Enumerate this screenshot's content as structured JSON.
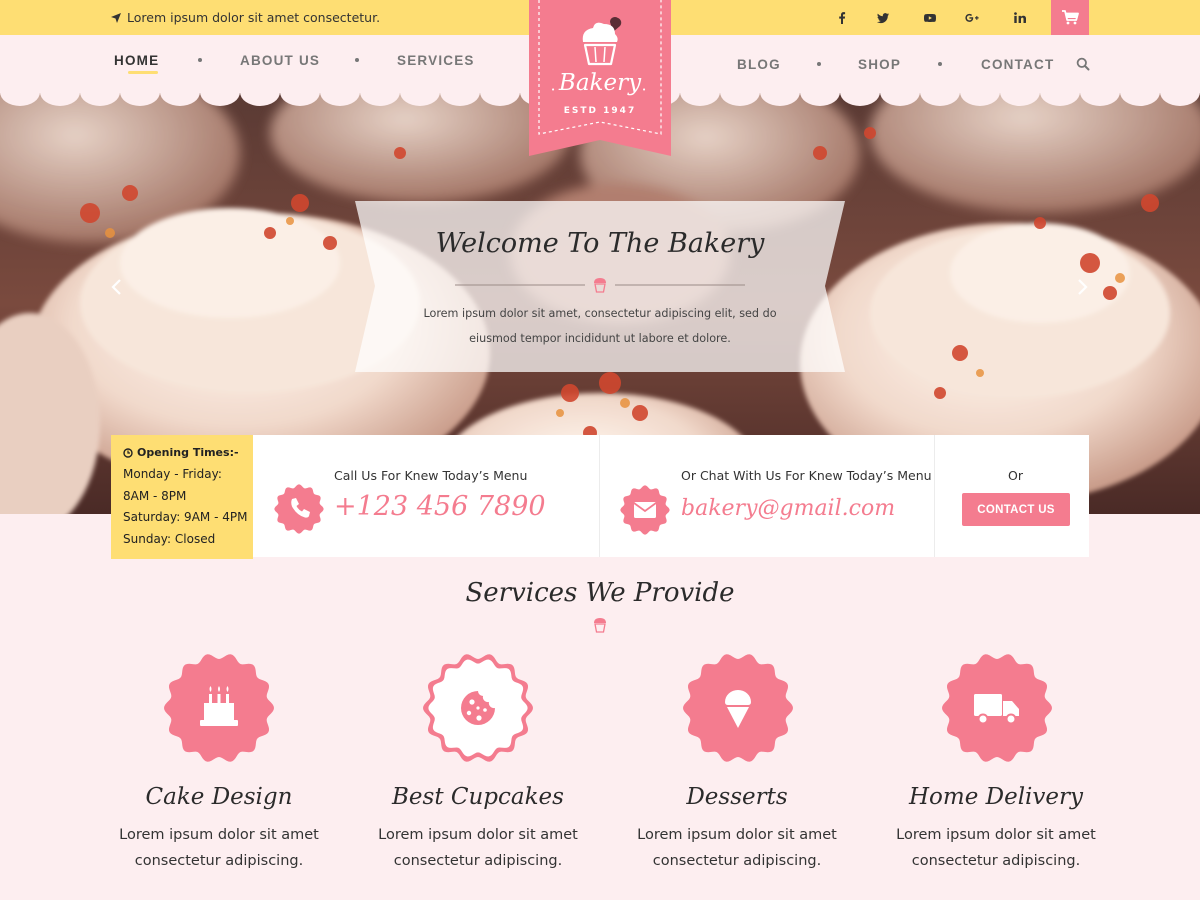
{
  "topbar": {
    "tagline": "Lorem ipsum dolor sit amet consectetur.",
    "social": [
      "facebook-icon",
      "twitter-icon",
      "youtube-icon",
      "google-plus-icon",
      "linkedin-icon"
    ],
    "cart_icon": "cart-icon"
  },
  "logo": {
    "title": "Bakery",
    "subtitle": "ESTD  1947"
  },
  "nav": {
    "left": [
      "HOME",
      "ABOUT US",
      "SERVICES"
    ],
    "right": [
      "BLOG",
      "SHOP",
      "CONTACT"
    ],
    "active": "HOME",
    "search_icon": "search-icon"
  },
  "hero": {
    "title": "Welcome To The Bakery",
    "text_line1": "Lorem ipsum dolor sit amet, consectetur adipiscing elit, sed do",
    "text_line2": "eiusmod tempor incididunt ut labore et dolore."
  },
  "hours": {
    "heading": "Opening Times:-",
    "line1": "Monday - Friday:",
    "line2": "8AM - 8PM",
    "line3": "Saturday: 9AM - 4PM",
    "line4": "Sunday: Closed"
  },
  "call": {
    "label": "Call Us For Knew Today’s Menu",
    "phone": "+123 456 7890"
  },
  "chat": {
    "label": "Or Chat With Us For Knew Today’s Menu",
    "email": "bakery@gmail.com"
  },
  "contact": {
    "or": "Or",
    "button": "CONTACT US"
  },
  "services": {
    "title": "Services We Provide",
    "items": [
      {
        "name": "Cake Design",
        "desc1": "Lorem ipsum dolor sit amet",
        "desc2": "consectetur adipiscing.",
        "icon": "cake-icon"
      },
      {
        "name": "Best Cupcakes",
        "desc1": "Lorem ipsum dolor sit amet",
        "desc2": "consectetur adipiscing.",
        "icon": "cookie-icon"
      },
      {
        "name": "Desserts",
        "desc1": "Lorem ipsum dolor sit amet",
        "desc2": "consectetur adipiscing.",
        "icon": "ice-cream-icon"
      },
      {
        "name": "Home Delivery",
        "desc1": "Lorem ipsum dolor sit amet",
        "desc2": "consectetur adipiscing.",
        "icon": "delivery-truck-icon"
      }
    ]
  },
  "colors": {
    "accent": "#f47c8f",
    "yellow": "#fede73",
    "background": "#fdeef0"
  }
}
